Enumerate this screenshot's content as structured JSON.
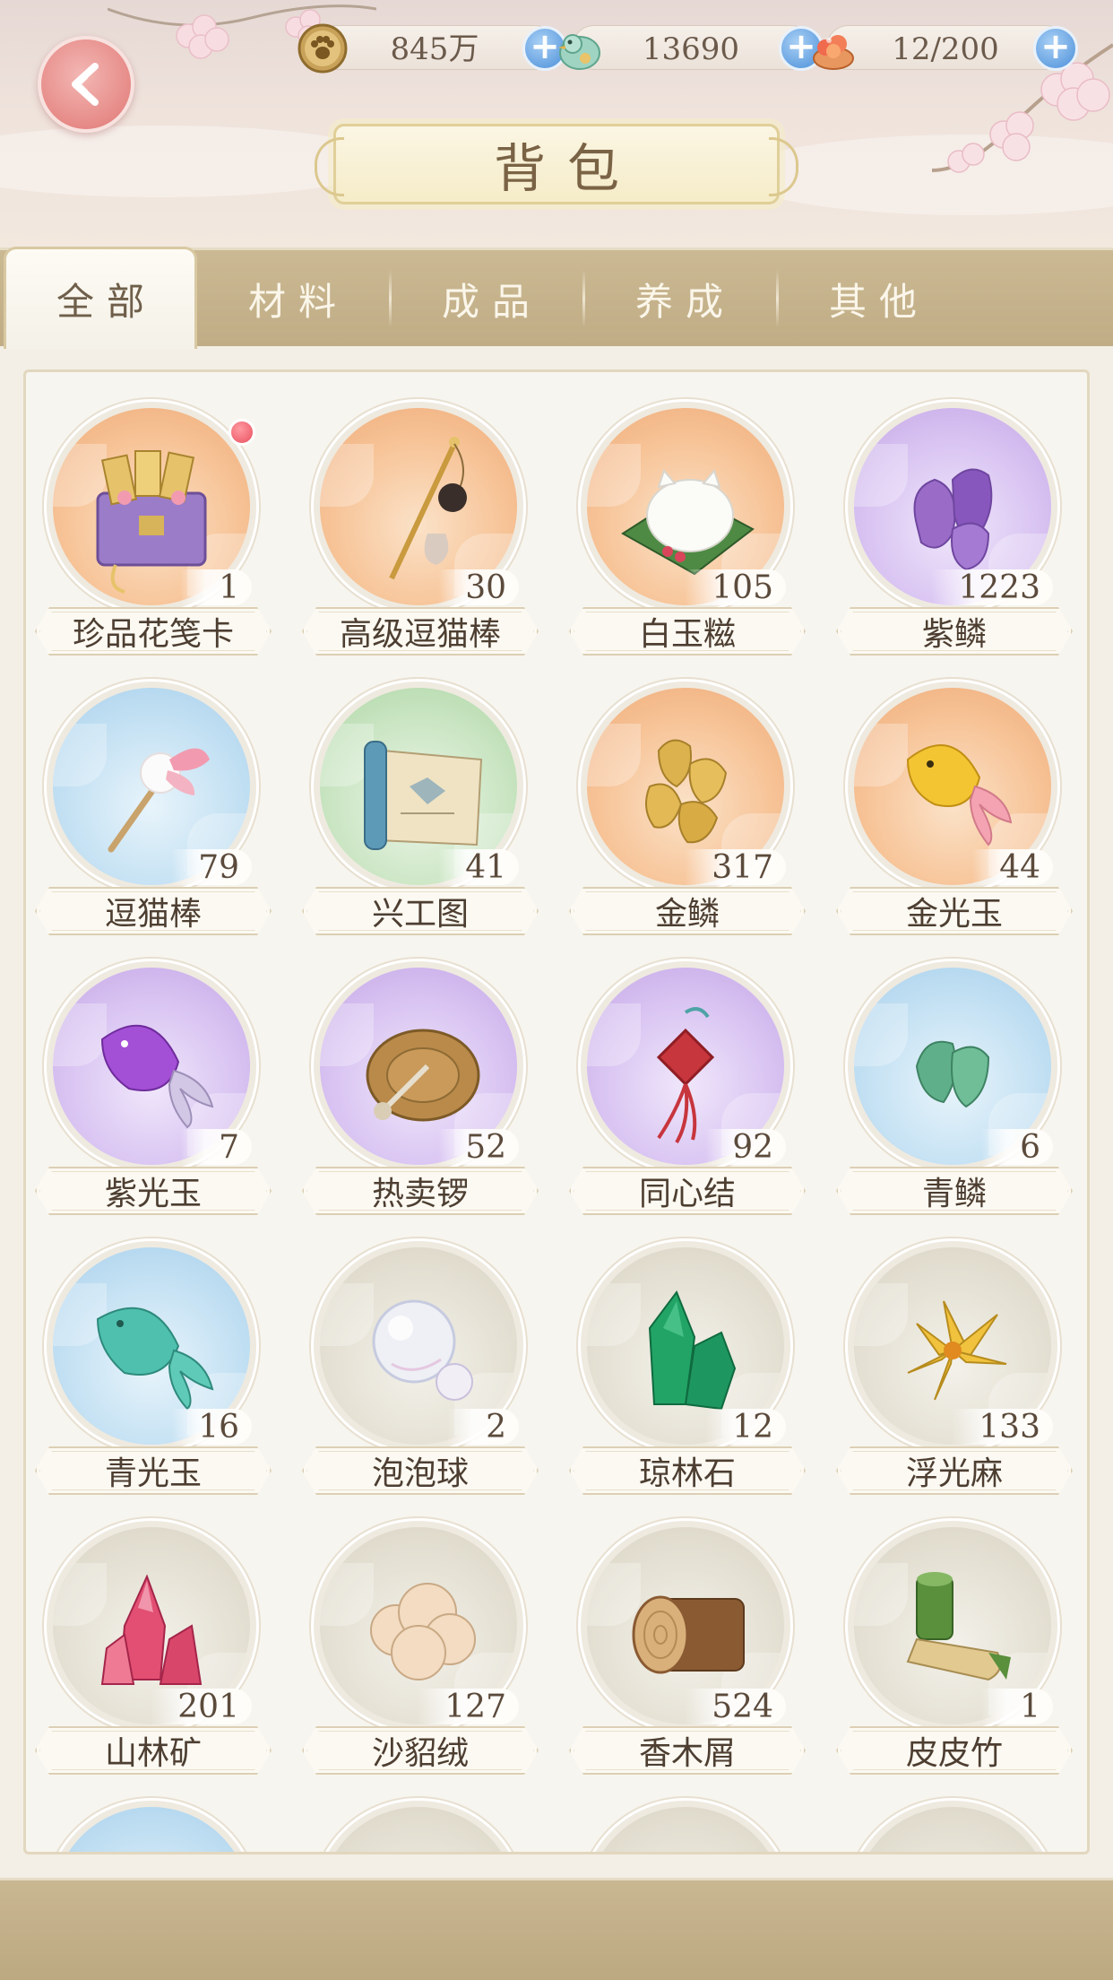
{
  "header": {
    "title": "背包",
    "currencies": [
      {
        "name": "paw-coin",
        "value": "845万"
      },
      {
        "name": "jade-bird",
        "value": "13690"
      },
      {
        "name": "food-bowl",
        "value": "12/200"
      }
    ]
  },
  "tabs": [
    {
      "label": "全部",
      "active": true
    },
    {
      "label": "材料",
      "active": false
    },
    {
      "label": "成品",
      "active": false
    },
    {
      "label": "养成",
      "active": false
    },
    {
      "label": "其他",
      "active": false
    }
  ],
  "items": [
    {
      "name": "珍品花笺卡",
      "count": "1",
      "bg": "orange",
      "icon": "card-chest-icon",
      "badge": true
    },
    {
      "name": "高级逗猫棒",
      "count": "30",
      "bg": "orange",
      "icon": "cat-wand-deluxe-icon"
    },
    {
      "name": "白玉糍",
      "count": "105",
      "bg": "orange",
      "icon": "rice-cake-icon"
    },
    {
      "name": "紫鳞",
      "count": "1223",
      "bg": "purple",
      "icon": "purple-scale-icon"
    },
    {
      "name": "逗猫棒",
      "count": "79",
      "bg": "blue",
      "icon": "cat-wand-icon"
    },
    {
      "name": "兴工图",
      "count": "41",
      "bg": "green",
      "icon": "scroll-map-icon"
    },
    {
      "name": "金鳞",
      "count": "317",
      "bg": "orange",
      "icon": "gold-scale-icon"
    },
    {
      "name": "金光玉",
      "count": "44",
      "bg": "orange",
      "icon": "gold-fish-jade-icon"
    },
    {
      "name": "紫光玉",
      "count": "7",
      "bg": "purple",
      "icon": "purple-fish-jade-icon"
    },
    {
      "name": "热卖锣",
      "count": "52",
      "bg": "purple",
      "icon": "gong-icon"
    },
    {
      "name": "同心结",
      "count": "92",
      "bg": "purple",
      "icon": "chinese-knot-icon"
    },
    {
      "name": "青鳞",
      "count": "6",
      "bg": "blue",
      "icon": "green-scale-icon"
    },
    {
      "name": "青光玉",
      "count": "16",
      "bg": "blue",
      "icon": "teal-fish-jade-icon"
    },
    {
      "name": "泡泡球",
      "count": "2",
      "bg": "grey",
      "icon": "bubble-icon"
    },
    {
      "name": "琼林石",
      "count": "12",
      "bg": "grey",
      "icon": "emerald-crystal-icon"
    },
    {
      "name": "浮光麻",
      "count": "133",
      "bg": "grey",
      "icon": "yellow-flower-icon"
    },
    {
      "name": "山林矿",
      "count": "201",
      "bg": "grey",
      "icon": "pink-crystal-icon"
    },
    {
      "name": "沙貂绒",
      "count": "127",
      "bg": "grey",
      "icon": "fluff-ball-icon"
    },
    {
      "name": "香木屑",
      "count": "524",
      "bg": "grey",
      "icon": "wood-log-icon"
    },
    {
      "name": "皮皮竹",
      "count": "1",
      "bg": "grey",
      "icon": "bamboo-icon"
    }
  ]
}
